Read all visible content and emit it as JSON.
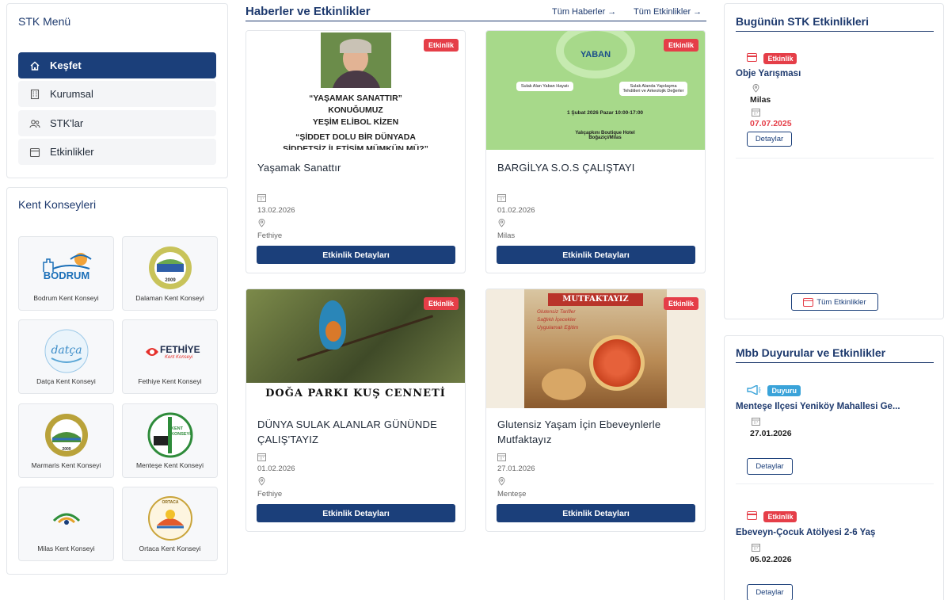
{
  "stk_menu": {
    "title": "STK Menü",
    "items": [
      {
        "label": "Keşfet"
      },
      {
        "label": "Kurumsal"
      },
      {
        "label": "STK'lar"
      },
      {
        "label": "Etkinlikler"
      }
    ]
  },
  "kent_konseyleri": {
    "title": "Kent Konseyleri",
    "items": [
      {
        "label": "Bodrum Kent Konseyi",
        "logo_text": "BODRUM"
      },
      {
        "label": "Dalaman Kent Konseyi",
        "logo_text": "2009"
      },
      {
        "label": "Datça Kent Konseyi",
        "logo_text": "datça"
      },
      {
        "label": "Fethiye Kent Konseyi",
        "logo_text": "FETHİYE",
        "logo_sub": "Kent Konseyi"
      },
      {
        "label": "Marmaris Kent Konseyi",
        "logo_text": "2009"
      },
      {
        "label": "Menteşe Kent Konseyi",
        "logo_text": "KENT KONSEYİ"
      },
      {
        "label": "Milas Kent Konseyi",
        "logo_text": ""
      },
      {
        "label": "Ortaca Kent Konseyi",
        "logo_text": "ORTACA"
      }
    ]
  },
  "news": {
    "title": "Haberler ve Etkinlikler",
    "link_all_news": "Tüm Haberler →",
    "link_all_events": "Tüm Etkinlikler →",
    "badge": "Etkinlik",
    "button_label": "Etkinlik Detayları",
    "cards": [
      {
        "title": "Yaşamak Sanattır",
        "date": "13.02.2026",
        "location": "Fethiye",
        "poster_lines": [
          "“YAŞAMAK SANATTIR”",
          "KONUĞUMUZ",
          "YEŞİM ELİBOL KİZEN",
          "“ŞİDDET DOLU BİR DÜNYADA",
          "ŞİDDETSİZ İLETİŞİM MÜMKÜN MÜ?”"
        ]
      },
      {
        "title": "BARGİLYA S.O.S ÇALIŞTAYI",
        "date": "01.02.2026",
        "location": "Milas",
        "poster_brand": "YABAN",
        "poster_left": "Sulak Alan Yaban Hayatı",
        "poster_right": "Sulak Alanda Yapılaşma Tehditleri ve Arkeolojik Değerler",
        "poster_when": "1 Şubat 2026 Pazar 10:00-17:00",
        "poster_where": "Yalıçapkını Boutique Hotel Boğaziçi/Milas"
      },
      {
        "title": "DÜNYA SULAK ALANLAR GÜNÜNDE ÇALIŞ'TAYIZ",
        "date": "01.02.2026",
        "location": "Fethiye",
        "poster_caption": "DOĞA PARKI KUŞ CENNETİ"
      },
      {
        "title": "Glutensiz Yaşam İçin Ebeveynlerle Mutfaktayız",
        "date": "27.01.2026",
        "location": "Menteşe",
        "poster_brand": "MUTFAKTAYIZ",
        "poster_items": [
          "Glutensiz Tarifler",
          "Sağlıklı İçecekler",
          "Uygulamalı Eğitim"
        ]
      }
    ]
  },
  "today": {
    "title": "Bugünün STK Etkinlikleri",
    "badge": "Etkinlik",
    "event_title": "Obje Yarışması",
    "location": "Milas",
    "date": "07.07.2025",
    "details": "Detaylar",
    "all_events": "Tüm Etkinlikler"
  },
  "mbb": {
    "title": "Mbb Duyurular ve Etkinlikler",
    "items": [
      {
        "badge": "Duyuru",
        "title": "Menteşe İlçesi Yeniköy Mahallesi Ge...",
        "date": "27.01.2026",
        "details": "Detaylar"
      },
      {
        "badge": "Etkinlik",
        "title": "Ebeveyn-Çocuk Atölyesi 2-6 Yaş",
        "date": "05.02.2026",
        "details": "Detaylar"
      }
    ]
  },
  "colors": {
    "primary": "#1b3f7a",
    "badge_red": "#e53e48",
    "badge_blue": "#3aa3d9"
  }
}
